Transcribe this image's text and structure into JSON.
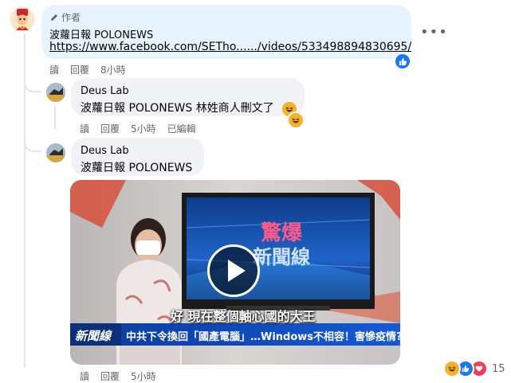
{
  "comment1": {
    "badge_label": "作者",
    "author": "波蘿日報 POLONEWS",
    "link_text": "https://www.facebook.com/SETho....../videos/533498894830695/",
    "actions": {
      "reply_short": "讀",
      "reply": "回覆",
      "time": "8小時"
    }
  },
  "reply1": {
    "author": "Deus Lab",
    "mention": "波蘿日報 POLONEWS",
    "text": " 林姓商人刪文了",
    "actions": {
      "reply_short": "讀",
      "reply": "回覆",
      "time": "5小時",
      "edited": "已編輯"
    }
  },
  "reply2": {
    "author": "Deus Lab",
    "mention": "波蘿日報 POLONEWS",
    "actions": {
      "reply_short": "讀",
      "reply": "回覆",
      "time": "5小時"
    },
    "video": {
      "tv_title_line1": "驚爆",
      "tv_title_line2": "新聞線",
      "subtitle": "好 現在整個軸心國的大王",
      "ticker_logo": "新聞線",
      "ticker_text": "中共下令換回「國產電腦」…Windows不相容！害慘疫情?"
    }
  },
  "reactions": {
    "count": "15",
    "icons": [
      "haha-icon",
      "like-icon",
      "love-icon"
    ]
  },
  "colors": {
    "facebook_blue": "#1877f2",
    "bubble": "#f0f2f5",
    "meta_text": "#65676b",
    "love_red": "#f33e58",
    "haha_yellow": "#f7b125"
  }
}
